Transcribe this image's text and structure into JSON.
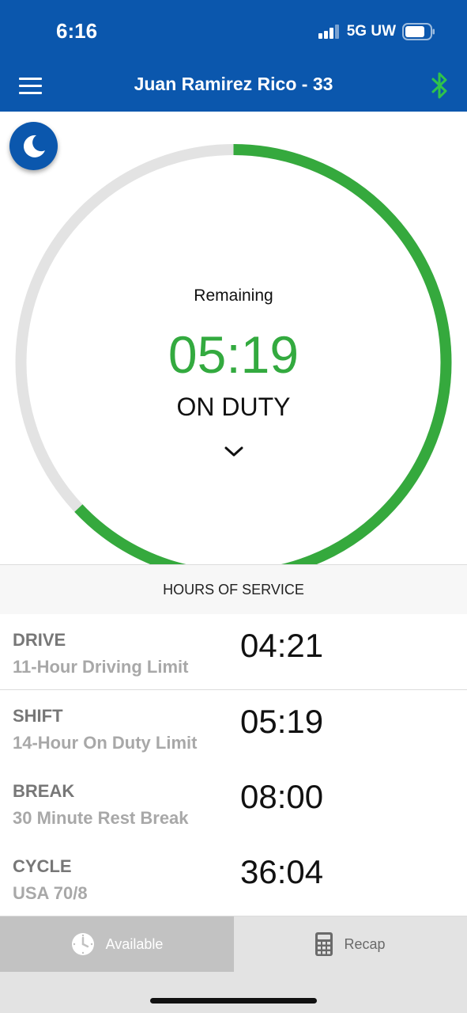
{
  "status_bar": {
    "time": "6:16",
    "network": "5G UW"
  },
  "app_bar": {
    "title": "Juan Ramirez Rico - 33"
  },
  "timer": {
    "label": "Remaining",
    "value": "05:19",
    "status": "ON DUTY",
    "progress_fraction": 0.63,
    "track_color": "#e3e3e3",
    "progress_color": "#35a93d"
  },
  "hos": {
    "header": "HOURS OF SERVICE",
    "rows": [
      {
        "title": "DRIVE",
        "subtitle": "11-Hour Driving Limit",
        "time": "04:21"
      },
      {
        "title": "SHIFT",
        "subtitle": "14-Hour On Duty Limit",
        "time": "05:19"
      },
      {
        "title": "BREAK",
        "subtitle": "30 Minute Rest Break",
        "time": "08:00"
      },
      {
        "title": "CYCLE",
        "subtitle": "USA 70/8",
        "time": "36:04"
      }
    ]
  },
  "tabs": [
    {
      "label": "Available",
      "icon": "clock-icon"
    },
    {
      "label": "Recap",
      "icon": "calculator-icon"
    }
  ],
  "colors": {
    "brand": "#0b57ad",
    "accent": "#33aa3f",
    "bluetooth": "#2fc34a"
  }
}
